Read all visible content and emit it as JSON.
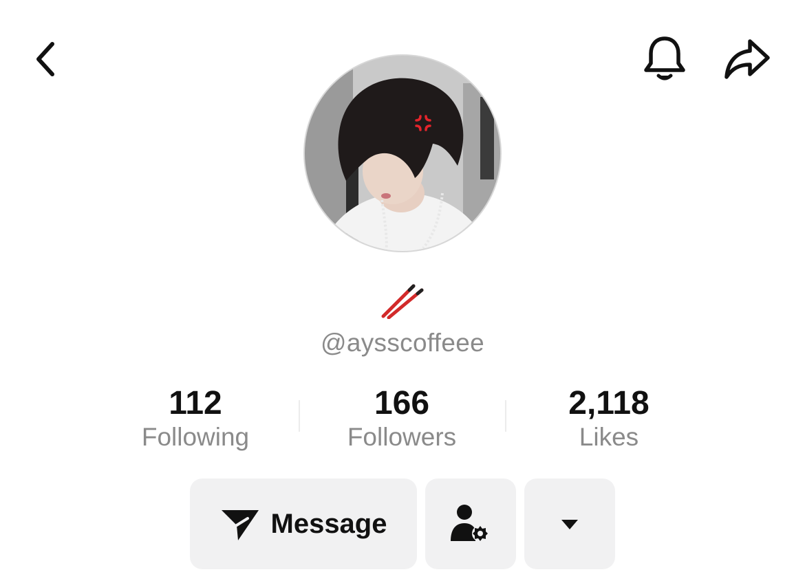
{
  "profile": {
    "handle": "@aysscoffeee",
    "nickname_icon": "chopsticks-emoji"
  },
  "stats": [
    {
      "value": "112",
      "label": "Following"
    },
    {
      "value": "166",
      "label": "Followers"
    },
    {
      "value": "2,118",
      "label": "Likes"
    }
  ],
  "actions": {
    "message_label": "Message",
    "message_icon": "send-icon",
    "friend_settings_icon": "user-gear-icon",
    "more_icon": "caret-down-icon"
  },
  "header": {
    "back_icon": "chevron-left-icon",
    "notifications_icon": "bell-icon",
    "share_icon": "share-arrow-icon"
  },
  "colors": {
    "accent_chopsticks": "#d22a2a",
    "button_bg": "#f1f1f2",
    "secondary_text": "#8a8a8a"
  }
}
